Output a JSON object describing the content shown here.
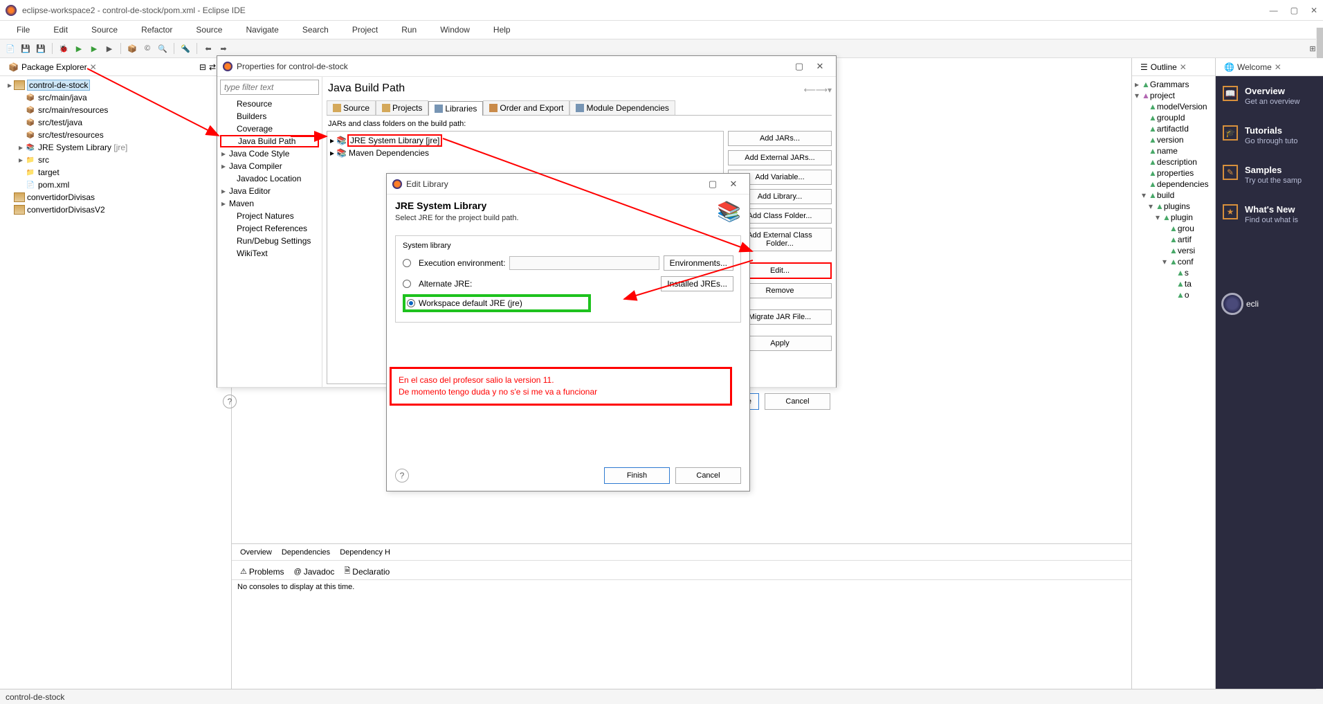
{
  "titlebar": {
    "title": "eclipse-workspace2 - control-de-stock/pom.xml - Eclipse IDE"
  },
  "menu": [
    "File",
    "Edit",
    "Source",
    "Refactor",
    "Source",
    "Navigate",
    "Search",
    "Project",
    "Run",
    "Window",
    "Help"
  ],
  "package_explorer": {
    "title": "Package Explorer",
    "items": [
      {
        "d": 0,
        "tw": "▸",
        "ico": "proj",
        "label": "control-de-stock",
        "sel": true
      },
      {
        "d": 1,
        "tw": "",
        "ico": "pkg",
        "label": "src/main/java"
      },
      {
        "d": 1,
        "tw": "",
        "ico": "pkg",
        "label": "src/main/resources"
      },
      {
        "d": 1,
        "tw": "",
        "ico": "pkg",
        "label": "src/test/java"
      },
      {
        "d": 1,
        "tw": "",
        "ico": "pkg",
        "label": "src/test/resources"
      },
      {
        "d": 1,
        "tw": "▸",
        "ico": "jar",
        "label": "JRE System Library",
        "suffix": "[jre]"
      },
      {
        "d": 1,
        "tw": "▸",
        "ico": "folder",
        "label": "src"
      },
      {
        "d": 1,
        "tw": "",
        "ico": "folder",
        "label": "target"
      },
      {
        "d": 1,
        "tw": "",
        "ico": "file",
        "label": "pom.xml"
      },
      {
        "d": 0,
        "tw": "",
        "ico": "proj",
        "label": "convertidorDivisas"
      },
      {
        "d": 0,
        "tw": "",
        "ico": "proj",
        "label": "convertidorDivisasV2"
      }
    ]
  },
  "props_dialog": {
    "title": "Properties for control-de-stock",
    "filter_placeholder": "type filter text",
    "nav": [
      {
        "tw": "",
        "label": "Resource",
        "d": 1
      },
      {
        "tw": "",
        "label": "Builders",
        "d": 1
      },
      {
        "tw": "",
        "label": "Coverage",
        "d": 1
      },
      {
        "tw": "",
        "label": "Java Build Path",
        "d": 1,
        "hi": true
      },
      {
        "tw": "▸",
        "label": "Java Code Style",
        "d": 0
      },
      {
        "tw": "▸",
        "label": "Java Compiler",
        "d": 0
      },
      {
        "tw": "",
        "label": "Javadoc Location",
        "d": 1
      },
      {
        "tw": "▸",
        "label": "Java Editor",
        "d": 0
      },
      {
        "tw": "▸",
        "label": "Maven",
        "d": 0
      },
      {
        "tw": "",
        "label": "Project Natures",
        "d": 1
      },
      {
        "tw": "",
        "label": "Project References",
        "d": 1
      },
      {
        "tw": "",
        "label": "Run/Debug Settings",
        "d": 1
      },
      {
        "tw": "",
        "label": "WikiText",
        "d": 1
      }
    ],
    "heading": "Java Build Path",
    "tabs": [
      "Source",
      "Projects",
      "Libraries",
      "Order and Export",
      "Module Dependencies"
    ],
    "active_tab": 2,
    "jar_label": "JARs and class folders on the build path:",
    "jar_items": [
      {
        "tw": "▸",
        "label": "JRE System Library [jre]",
        "hi": true
      },
      {
        "tw": "▸",
        "label": "Maven Dependencies"
      }
    ],
    "buttons": [
      "Add JARs...",
      "Add External JARs...",
      "Add Variable...",
      "Add Library...",
      "Add Class Folder...",
      "Add External Class Folder...",
      "",
      "Edit...",
      "Remove",
      "",
      "Migrate JAR File...",
      "",
      "Apply"
    ],
    "apply_close": "Apply and Close",
    "cancel": "Cancel"
  },
  "edit_dialog": {
    "title": "Edit Library",
    "heading": "JRE System Library",
    "subheading": "Select JRE for the project build path.",
    "group": "System library",
    "opt_exec": "Execution environment:",
    "opt_alt": "Alternate JRE:",
    "opt_ws": "Workspace default JRE (jre)",
    "env_btn": "Environments...",
    "installed_btn": "Installed JREs...",
    "finish": "Finish",
    "cancel": "Cancel"
  },
  "annotation": {
    "line1": "En el caso del profesor salio la version 11.",
    "line2": "De momento tengo duda y no s'e si me va a funcionar"
  },
  "outline": {
    "title": "Outline",
    "items": [
      {
        "d": 0,
        "tw": "▸",
        "c": "g",
        "label": "Grammars"
      },
      {
        "d": 0,
        "tw": "▾",
        "c": "p",
        "label": "project"
      },
      {
        "d": 1,
        "tw": "",
        "c": "g",
        "label": "modelVersion"
      },
      {
        "d": 1,
        "tw": "",
        "c": "g",
        "label": "groupId"
      },
      {
        "d": 1,
        "tw": "",
        "c": "g",
        "label": "artifactId"
      },
      {
        "d": 1,
        "tw": "",
        "c": "g",
        "label": "version"
      },
      {
        "d": 1,
        "tw": "",
        "c": "g",
        "label": "name"
      },
      {
        "d": 1,
        "tw": "",
        "c": "g",
        "label": "description"
      },
      {
        "d": 1,
        "tw": "",
        "c": "g",
        "label": "properties"
      },
      {
        "d": 1,
        "tw": "",
        "c": "g",
        "label": "dependencies"
      },
      {
        "d": 1,
        "tw": "▾",
        "c": "g",
        "label": "build"
      },
      {
        "d": 2,
        "tw": "▾",
        "c": "g",
        "label": "plugins"
      },
      {
        "d": 3,
        "tw": "▾",
        "c": "g",
        "label": "plugin"
      },
      {
        "d": 4,
        "tw": "",
        "c": "g",
        "label": "grou"
      },
      {
        "d": 4,
        "tw": "",
        "c": "g",
        "label": "artif"
      },
      {
        "d": 4,
        "tw": "",
        "c": "g",
        "label": "versi"
      },
      {
        "d": 4,
        "tw": "▾",
        "c": "g",
        "label": "conf"
      },
      {
        "d": 5,
        "tw": "",
        "c": "g",
        "label": "s"
      },
      {
        "d": 5,
        "tw": "",
        "c": "g",
        "label": "ta"
      },
      {
        "d": 5,
        "tw": "",
        "c": "g",
        "label": "o"
      }
    ]
  },
  "welcome": {
    "title": "Welcome",
    "items": [
      {
        "icon": "📖",
        "h": "Overview",
        "s": "Get an overview"
      },
      {
        "icon": "🎓",
        "h": "Tutorials",
        "s": "Go through tuto"
      },
      {
        "icon": "✎",
        "h": "Samples",
        "s": "Try out the samp"
      },
      {
        "icon": "★",
        "h": "What's New",
        "s": "Find out what is"
      }
    ],
    "logo": "ecli"
  },
  "bottom": {
    "tabs1": [
      "Overview",
      "Dependencies",
      "Dependency H"
    ],
    "tabs2": [
      "Problems",
      "Javadoc",
      "Declaratio"
    ],
    "console_msg": "No consoles to display at this time."
  },
  "status": "control-de-stock"
}
